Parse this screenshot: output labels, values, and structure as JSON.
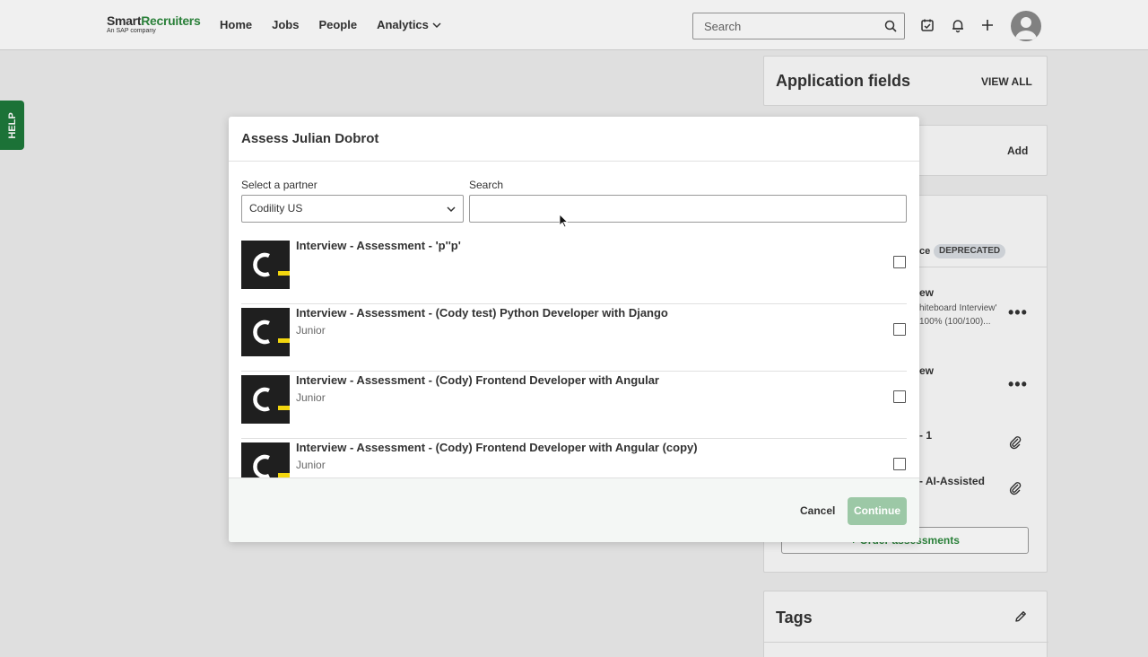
{
  "header": {
    "logo": {
      "brand_primary": "Smart",
      "brand_secondary": "Recruiters",
      "subtitle": "An SAP company"
    },
    "nav": [
      {
        "label": "Home"
      },
      {
        "label": "Jobs"
      },
      {
        "label": "People"
      },
      {
        "label": "Analytics"
      }
    ],
    "search_placeholder": "Search",
    "icons": [
      "calendar-check-icon",
      "bell-icon",
      "plus-icon",
      "user-avatar-icon"
    ]
  },
  "help_tab": {
    "label": "HELP"
  },
  "background": {
    "application_fields": {
      "title": "Application fields",
      "action": "VIEW ALL"
    },
    "add_card": {
      "action": "Add"
    },
    "assessments": {
      "badge": "DEPRECATED",
      "partial_label_ce": "ce",
      "item1_title": "ew",
      "item1_detail_1": "hiteboard Interview'",
      "item1_detail_2": "100% (100/100)...",
      "item2_title": "ew",
      "item3_title": "- 1",
      "item4_title": "- AI-Assisted",
      "order_button": "+ Order assessments"
    },
    "tags": {
      "title": "Tags"
    }
  },
  "modal": {
    "title": "Assess Julian Dobrot",
    "partner_label": "Select a partner",
    "partner_value": "Codility US",
    "search_label": "Search",
    "search_value": "",
    "items": [
      {
        "title": "Interview - Assessment - 'p''p'",
        "level": ""
      },
      {
        "title": "Interview - Assessment - (Cody test) Python Developer with Django",
        "level": "Junior"
      },
      {
        "title": "Interview - Assessment - (Cody) Frontend Developer with Angular",
        "level": "Junior"
      },
      {
        "title": "Interview - Assessment - (Cody) Frontend Developer with Angular (copy)",
        "level": "Junior"
      }
    ],
    "cancel_label": "Cancel",
    "continue_label": "Continue"
  },
  "colors": {
    "brand_green": "#2f8a3f",
    "help_green": "#1e7a3b",
    "continue_disabled": "#9cc8a6",
    "codility_yellow": "#f2d60e"
  }
}
